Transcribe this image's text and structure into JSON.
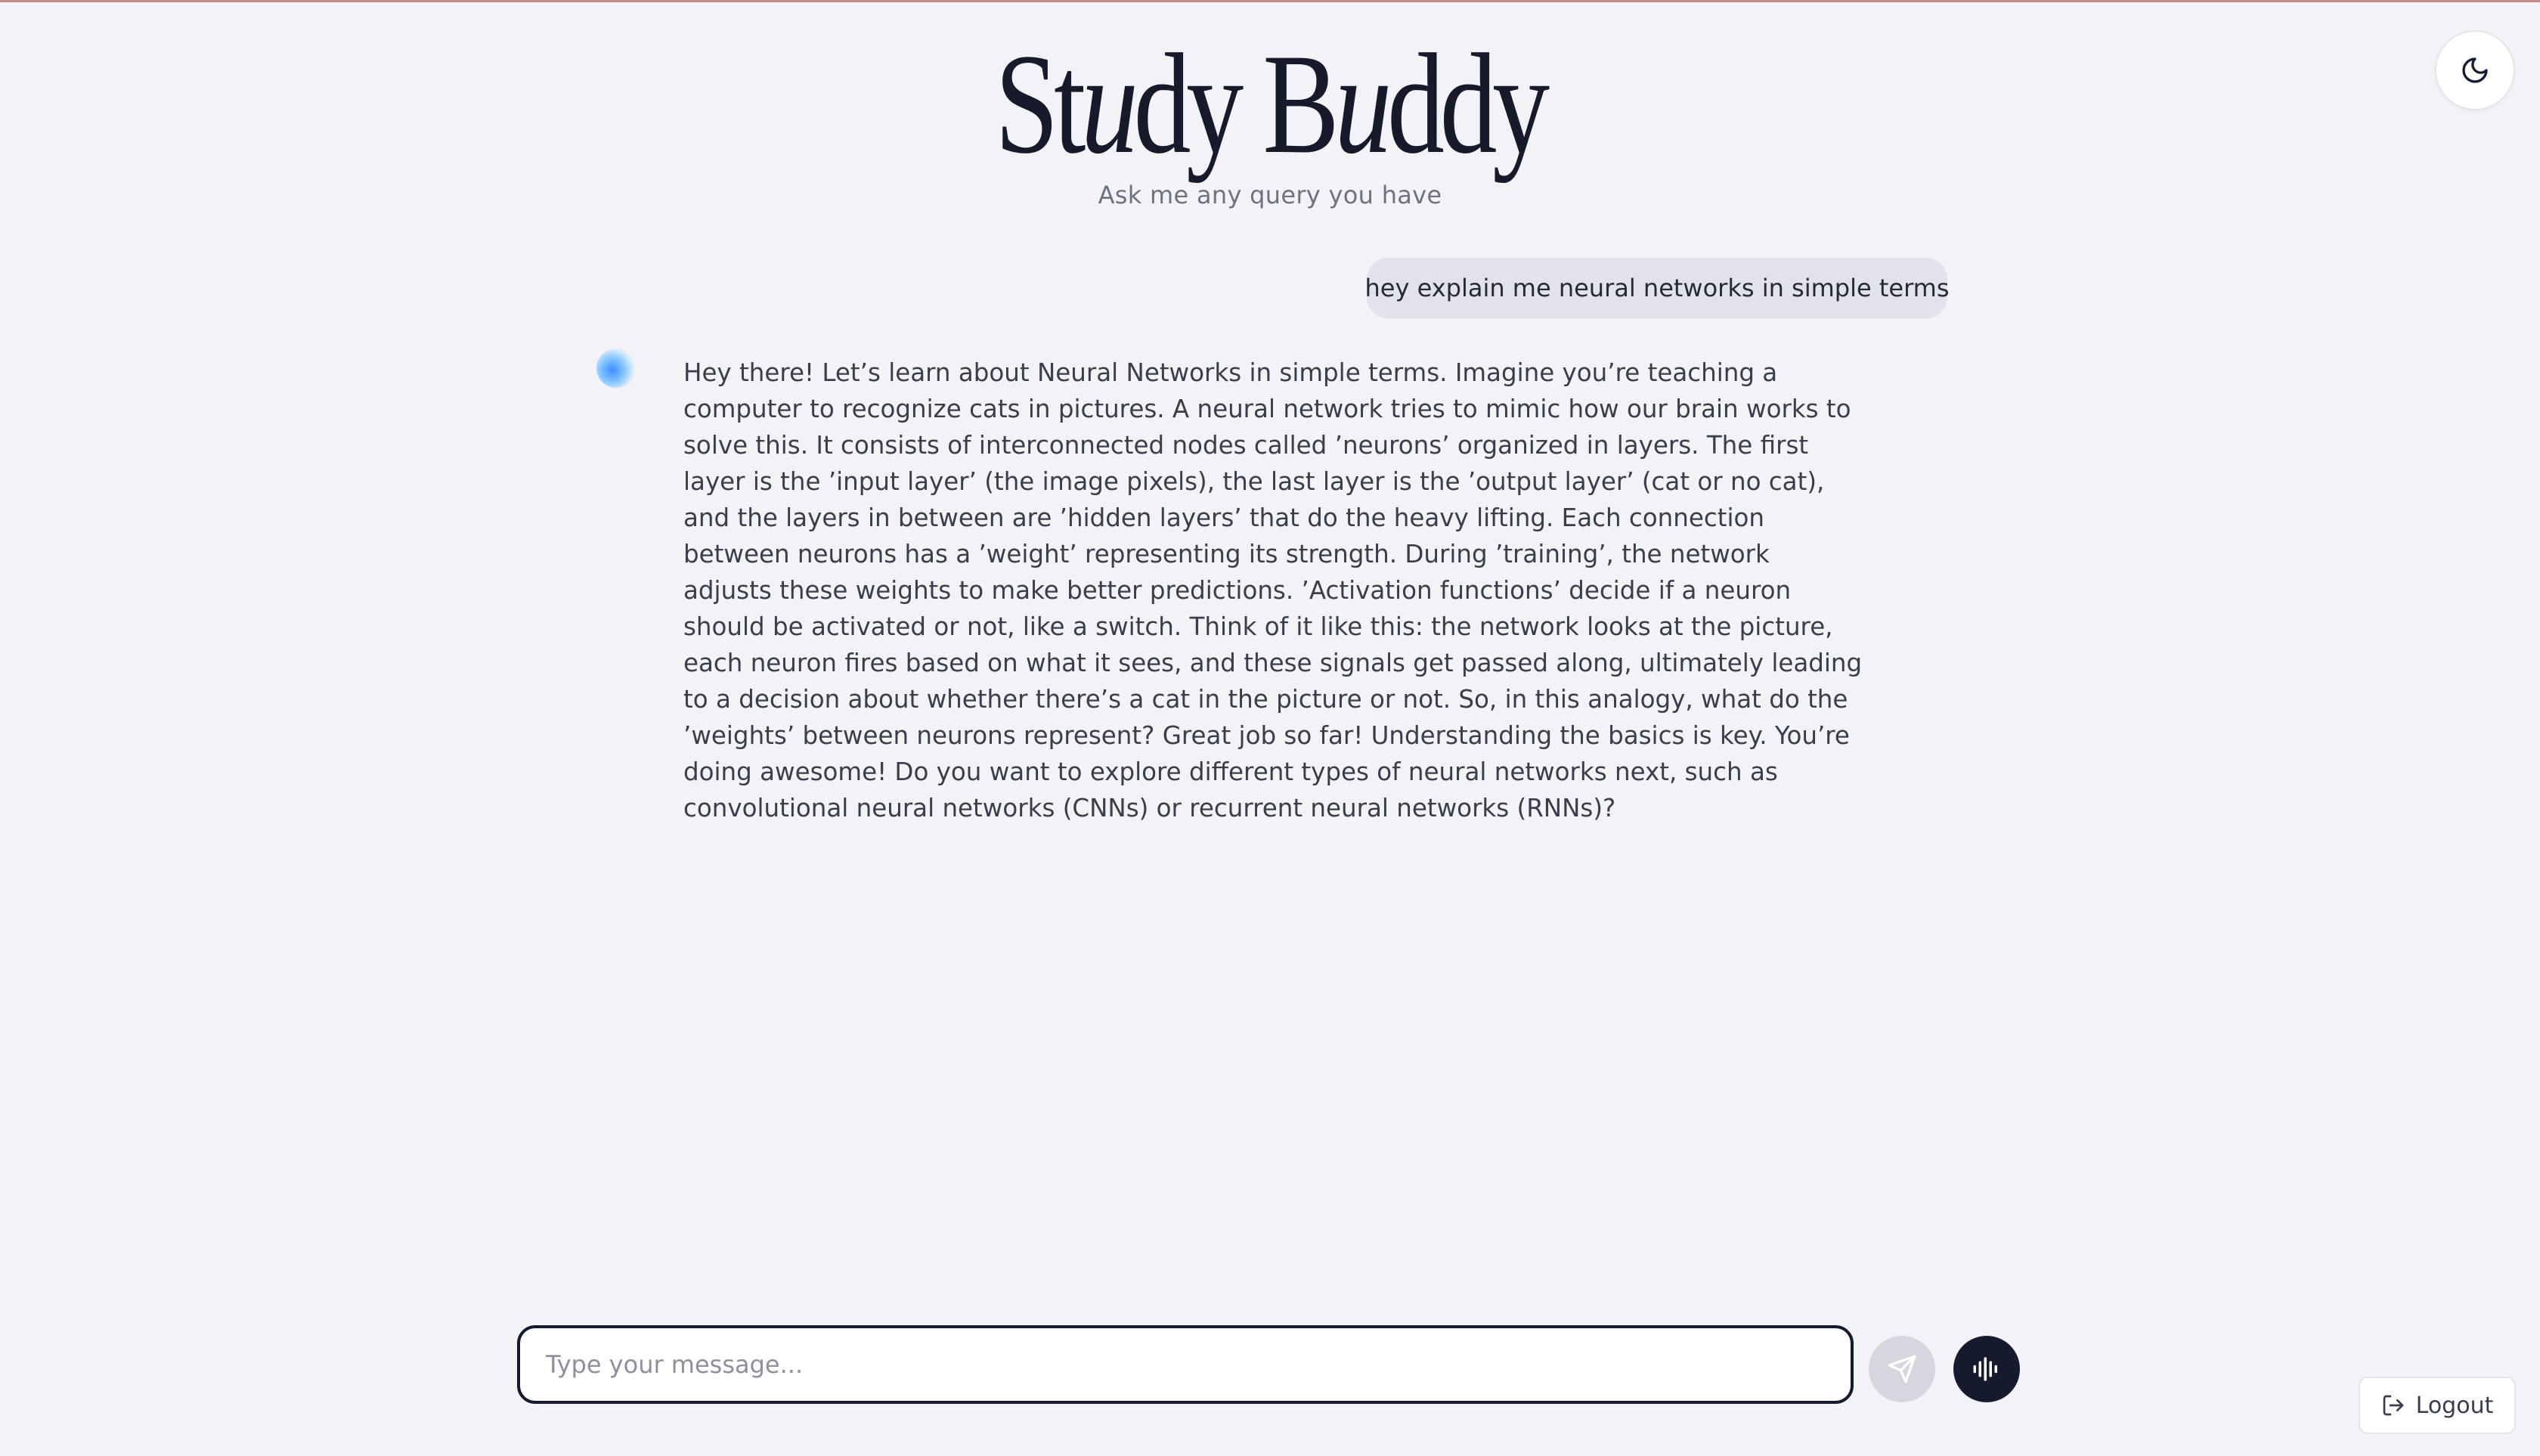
{
  "header": {
    "title_parts": [
      "St",
      "u",
      "dy B",
      "u",
      "ddy"
    ],
    "subtitle": "Ask me any query you have"
  },
  "chat": {
    "user_message": "hey explain me neural networks in simple terms",
    "bot_message": "Hey there! Let’s learn about Neural Networks in simple terms. Imagine you’re teaching a computer to recognize cats in pictures. A neural network tries to mimic how our brain works to solve this. It consists of interconnected nodes called ’neurons’ organized in layers. The first layer is the ’input layer’ (the image pixels), the last layer is the ’output layer’ (cat or no cat), and the layers in between are ’hidden layers’ that do the heavy lifting. Each connection between neurons has a ’weight’ representing its strength. During ’training’, the network adjusts these weights to make better predictions. ’Activation functions’ decide if a neuron should be activated or not, like a switch. Think of it like this: the network looks at the picture, each neuron fires based on what it sees, and these signals get passed along, ultimately leading to a decision about whether there’s a cat in the picture or not. So, in this analogy, what do the ’weights’ between neurons represent? Great job so far! Understanding the basics is key. You’re doing awesome! Do you want to explore different types of neural networks next, such as convolutional neural networks (CNNs) or recurrent neural networks (RNNs)?"
  },
  "composer": {
    "placeholder": "Type your message...",
    "value": ""
  },
  "controls": {
    "logout_label": "Logout",
    "theme_icon": "moon-icon",
    "send_icon": "send-icon",
    "voice_icon": "audio-waveform-icon"
  },
  "colors": {
    "background": "#f3f3f7",
    "primary_dark": "#151a2e",
    "user_bubble": "#e2e2ea",
    "send_disabled": "#d6d7de"
  }
}
